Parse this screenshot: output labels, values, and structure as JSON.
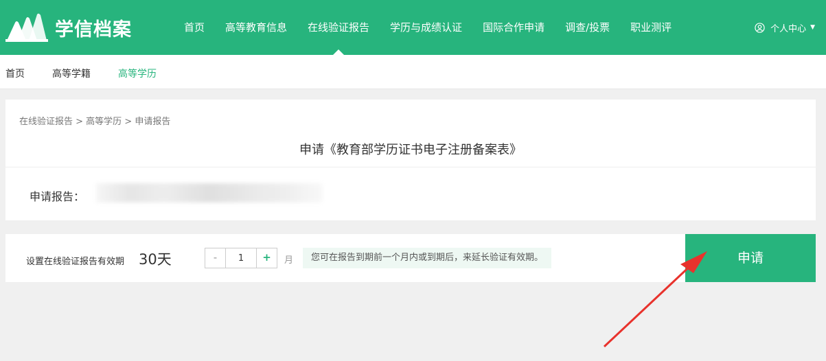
{
  "header": {
    "logo_text": "学信档案",
    "nav": [
      {
        "label": "首页"
      },
      {
        "label": "高等教育信息"
      },
      {
        "label": "在线验证报告"
      },
      {
        "label": "学历与成绩认证"
      },
      {
        "label": "国际合作申请"
      },
      {
        "label": "调查/投票"
      },
      {
        "label": "职业测评"
      }
    ],
    "active_nav": "在线验证报告",
    "user_center": "个人中心"
  },
  "subnav": {
    "items": [
      {
        "label": "首页"
      },
      {
        "label": "高等学籍"
      },
      {
        "label": "高等学历"
      }
    ],
    "active": "高等学历"
  },
  "main": {
    "breadcrumb": "在线验证报告 > 高等学历 > 申请报告",
    "title": "申请《教育部学历证书电子注册备案表》",
    "report_label": "申请报告："
  },
  "validity": {
    "label": "设置在线验证报告有效期",
    "days": "30天",
    "minus": "-",
    "value": "1",
    "plus": "+",
    "unit": "月",
    "hint": "您可在报告到期前一个月内或到期后，来延长验证有效期。"
  },
  "apply_label": "申请",
  "colors": {
    "brand": "#27b47d",
    "annotation_arrow": "#e8322c"
  }
}
